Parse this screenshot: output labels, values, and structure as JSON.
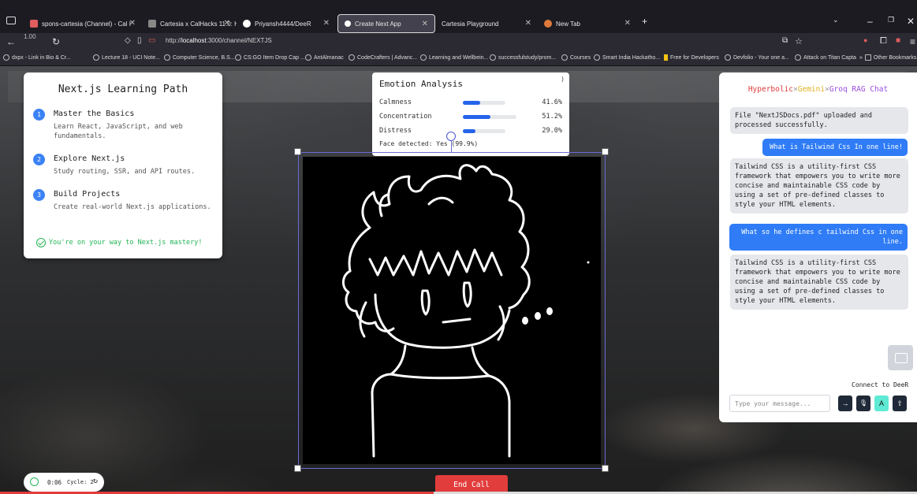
{
  "browser": {
    "tabs": [
      {
        "label": "spons-cartesia (Channel) - Cal I",
        "color": "#e05d5d"
      },
      {
        "label": "Cartesia x CalHacks 11.0: Hacke",
        "color": "#888888"
      },
      {
        "label": "Priyansh4444/DeeR",
        "color": "#ffffff"
      },
      {
        "label": "Create Next App",
        "color": "#ffffff"
      },
      {
        "label": "Cartesia Playground",
        "color": "#444444"
      },
      {
        "label": "New Tab",
        "color": "#e07a3a"
      }
    ],
    "zoom": "1.00",
    "url_prefix": "http://",
    "url_host": "localhost",
    "url_rest": ":3000/channel/NEXTJS",
    "bookmarks": [
      "dxpx - Link in Bio & Cr...",
      "Lecture 18 - UCI Note...",
      "Computer Science, B.S...",
      "CS:GO Item Drop Cap ...",
      "AntAlmanac",
      "CodeCrafters | Advanc...",
      "Learning and Wellbein...",
      "successfulstudy/prom...",
      "Courses",
      "Smart India Hackatho...",
      "Free for Developers",
      "Devfolio - Your one a...",
      "Attack on Titan Capta",
      "Other Bookmarks"
    ]
  },
  "learning_path": {
    "title": "Next.js Learning Path",
    "steps": [
      {
        "num": "1",
        "title": "Master the Basics",
        "desc": "Learn React, JavaScript, and web fundamentals."
      },
      {
        "num": "2",
        "title": "Explore Next.js",
        "desc": "Study routing, SSR, and API routes."
      },
      {
        "num": "3",
        "title": "Build Projects",
        "desc": "Create real-world Next.js applications."
      }
    ],
    "footer": "You're on your way to Next.js mastery!"
  },
  "emotion": {
    "title": "Emotion Analysis",
    "paren": ")",
    "rows": [
      {
        "label": "Calmness",
        "value": "41.6%",
        "fraction": 0.416
      },
      {
        "label": "Concentration",
        "value": "51.2%",
        "fraction": 0.512
      },
      {
        "label": "Distress",
        "value": "29.0%",
        "fraction": 0.29
      }
    ],
    "face": "Face detected: Yes (99.9%)"
  },
  "chat": {
    "title_parts": [
      "Hyperbolic",
      "×",
      "Gemini",
      "×",
      "Groq RAG Chat"
    ],
    "messages": [
      {
        "role": "bot",
        "text": "File \"NextJSDocs.pdf\" uploaded and processed successfully."
      },
      {
        "role": "user",
        "text": "What is Tailwind Css In one line!"
      },
      {
        "role": "bot",
        "text": "Tailwind CSS is a utility-first CSS framework that empowers you to write more concise and maintainable CSS code by using a set of pre-defined classes to style your HTML elements."
      },
      {
        "role": "user",
        "text": "What so he defines c tailwind Css in one line."
      },
      {
        "role": "bot",
        "text": "Tailwind CSS is a utility-first CSS framework that empowers you to write more concise and maintainable CSS code by using a set of pre-defined classes to style your HTML elements."
      }
    ],
    "connect_label": "Connect to DeeR",
    "input_placeholder": "Type your message...",
    "buttons": [
      "→",
      "🎙",
      "A",
      "⇧"
    ]
  },
  "controls": {
    "time": "0:06",
    "cycle": "Cycle: 2",
    "end_call": "End Call"
  },
  "colors": {
    "accent_blue": "#2563eb",
    "success_green": "#22b455",
    "end_call_red": "#e23d3d"
  }
}
